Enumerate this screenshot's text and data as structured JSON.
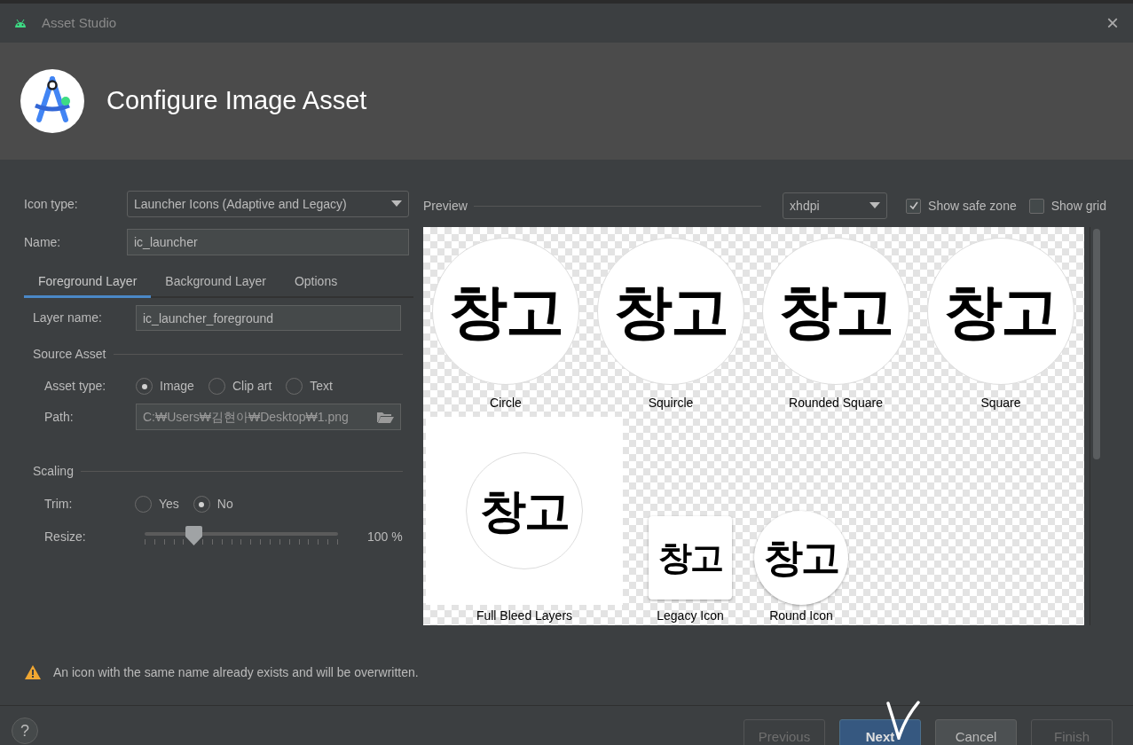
{
  "window": {
    "title": "Asset Studio",
    "close": "×"
  },
  "header": {
    "title": "Configure Image Asset"
  },
  "form": {
    "icon_type": {
      "label": "Icon type:",
      "value": "Launcher Icons (Adaptive and Legacy)"
    },
    "name": {
      "label": "Name:",
      "value": "ic_launcher"
    },
    "tabs": [
      {
        "label": "Foreground Layer",
        "selected": true
      },
      {
        "label": "Background Layer",
        "selected": false
      },
      {
        "label": "Options",
        "selected": false
      }
    ],
    "layer_name": {
      "label": "Layer name:",
      "value": "ic_launcher_foreground"
    },
    "source_asset": {
      "title": "Source Asset",
      "asset_type_label": "Asset type:",
      "asset_types": [
        {
          "label": "Image",
          "selected": true
        },
        {
          "label": "Clip art",
          "selected": false
        },
        {
          "label": "Text",
          "selected": false
        }
      ],
      "path_label": "Path:",
      "path": "C:₩Users₩김현아₩Desktop₩1.png"
    },
    "scaling": {
      "title": "Scaling",
      "trim_label": "Trim:",
      "trim": [
        {
          "label": "Yes",
          "selected": false
        },
        {
          "label": "No",
          "selected": true
        }
      ],
      "resize_label": "Resize:",
      "resize": {
        "level": 0.25,
        "reading": "100 %"
      }
    }
  },
  "preview": {
    "label": "Preview",
    "density": "xhdpi",
    "show_safe_zone": {
      "label": "Show safe zone",
      "checked": true
    },
    "show_grid": {
      "label": "Show grid",
      "checked": false
    },
    "icons": [
      {
        "kind": "circle",
        "text": "창고",
        "label": "Circle"
      },
      {
        "kind": "circle",
        "text": "창고",
        "label": "Squircle"
      },
      {
        "kind": "circle",
        "text": "창고",
        "label": "Rounded Square"
      },
      {
        "kind": "circle",
        "text": "창고",
        "label": "Square"
      },
      {
        "kind": "full",
        "text": "창고",
        "label": "Full Bleed Layers"
      },
      {
        "kind": "legacy",
        "text": "창고",
        "label": "Legacy Icon"
      },
      {
        "kind": "round",
        "text": "창고",
        "label": "Round Icon"
      }
    ]
  },
  "warning": "An icon with the same name already exists and will be overwritten.",
  "help": "?",
  "buttons": [
    {
      "label": "Previous",
      "disabled": true,
      "primary": false
    },
    {
      "label": "Next",
      "disabled": false,
      "primary": true
    },
    {
      "label": "Cancel",
      "disabled": false,
      "primary": false
    },
    {
      "label": "Finish",
      "disabled": true,
      "primary": false
    }
  ]
}
